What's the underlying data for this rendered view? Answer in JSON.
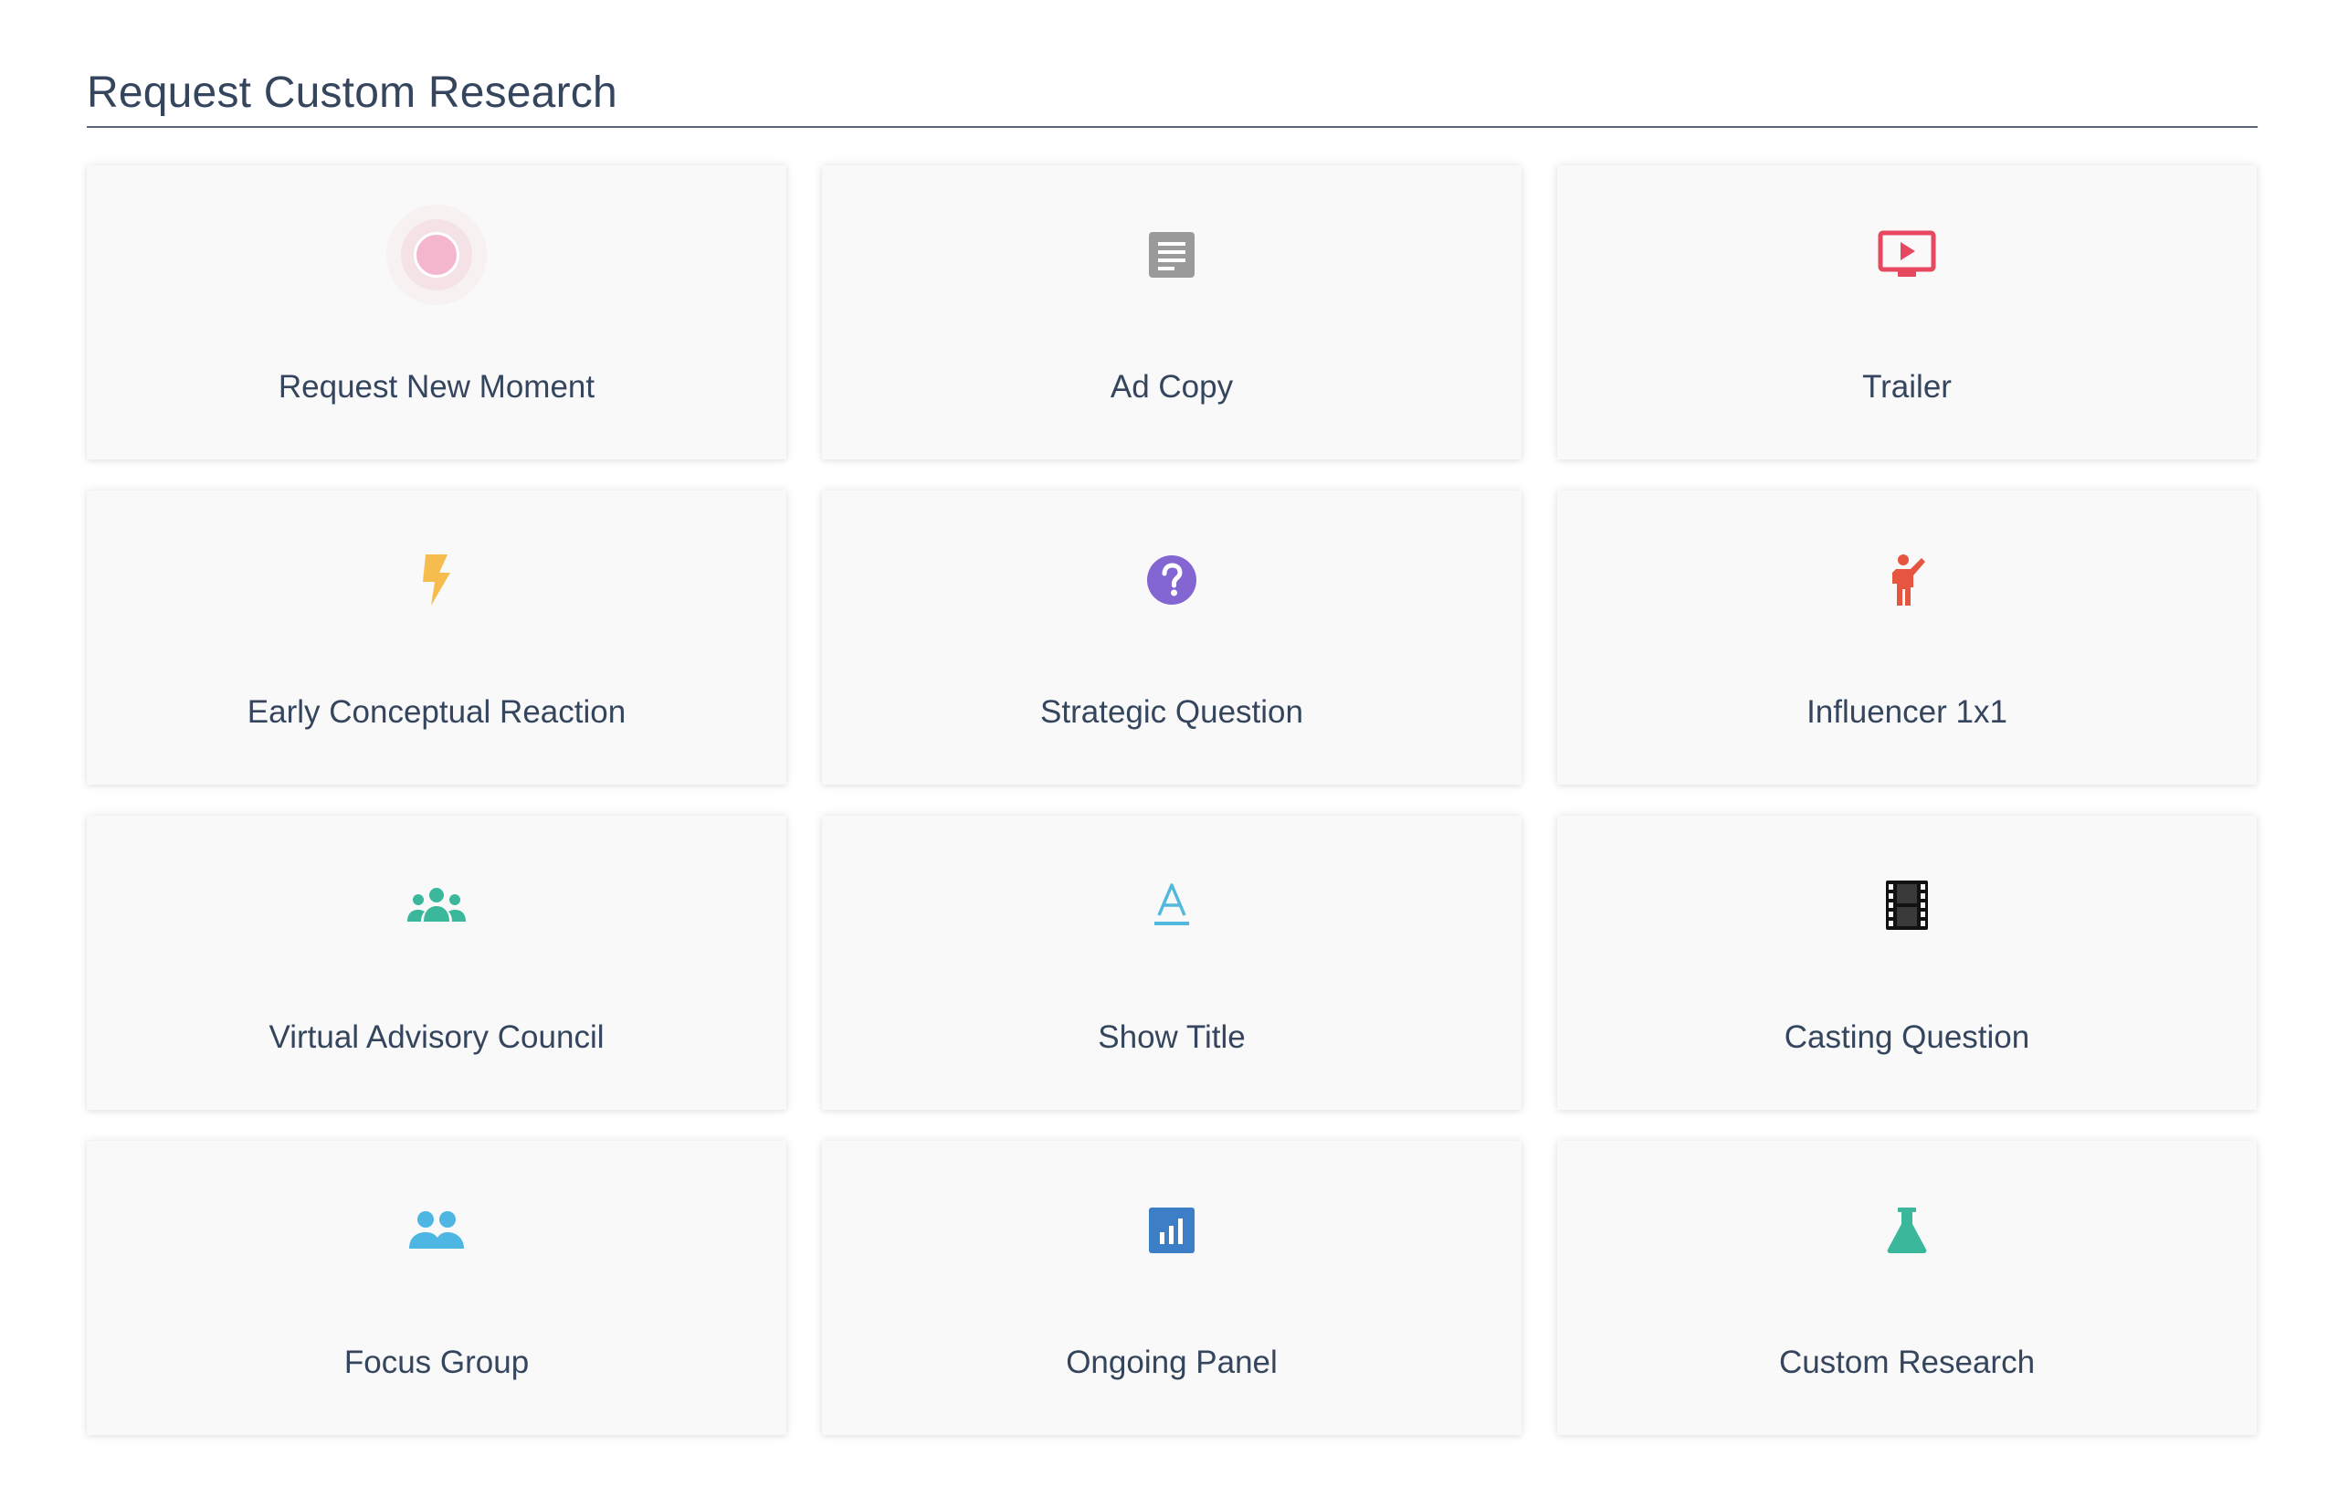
{
  "page": {
    "title": "Request Custom Research"
  },
  "cards": [
    {
      "label": "Request New Moment",
      "icon": "pulse-dot-icon",
      "color": "#f4b6cf"
    },
    {
      "label": "Ad Copy",
      "icon": "document-icon",
      "color": "#9a9a9a"
    },
    {
      "label": "Trailer",
      "icon": "video-play-icon",
      "color": "#e5485f"
    },
    {
      "label": "Early Conceptual Reaction",
      "icon": "lightning-bolt-icon",
      "color": "#f6bd4e"
    },
    {
      "label": "Strategic Question",
      "icon": "question-circle-icon",
      "color": "#8366d1"
    },
    {
      "label": "Influencer 1x1",
      "icon": "person-waving-icon",
      "color": "#e55540"
    },
    {
      "label": "Virtual Advisory Council",
      "icon": "group-icon",
      "color": "#3bb89b"
    },
    {
      "label": "Show Title",
      "icon": "text-format-icon",
      "color": "#52b9dd"
    },
    {
      "label": "Casting Question",
      "icon": "film-strip-icon",
      "color": "#111111"
    },
    {
      "label": "Focus Group",
      "icon": "people-icon",
      "color": "#4db6e2"
    },
    {
      "label": "Ongoing Panel",
      "icon": "bar-chart-icon",
      "color": "#3d7fc6"
    },
    {
      "label": "Custom Research",
      "icon": "flask-icon",
      "color": "#3bb89b"
    }
  ]
}
